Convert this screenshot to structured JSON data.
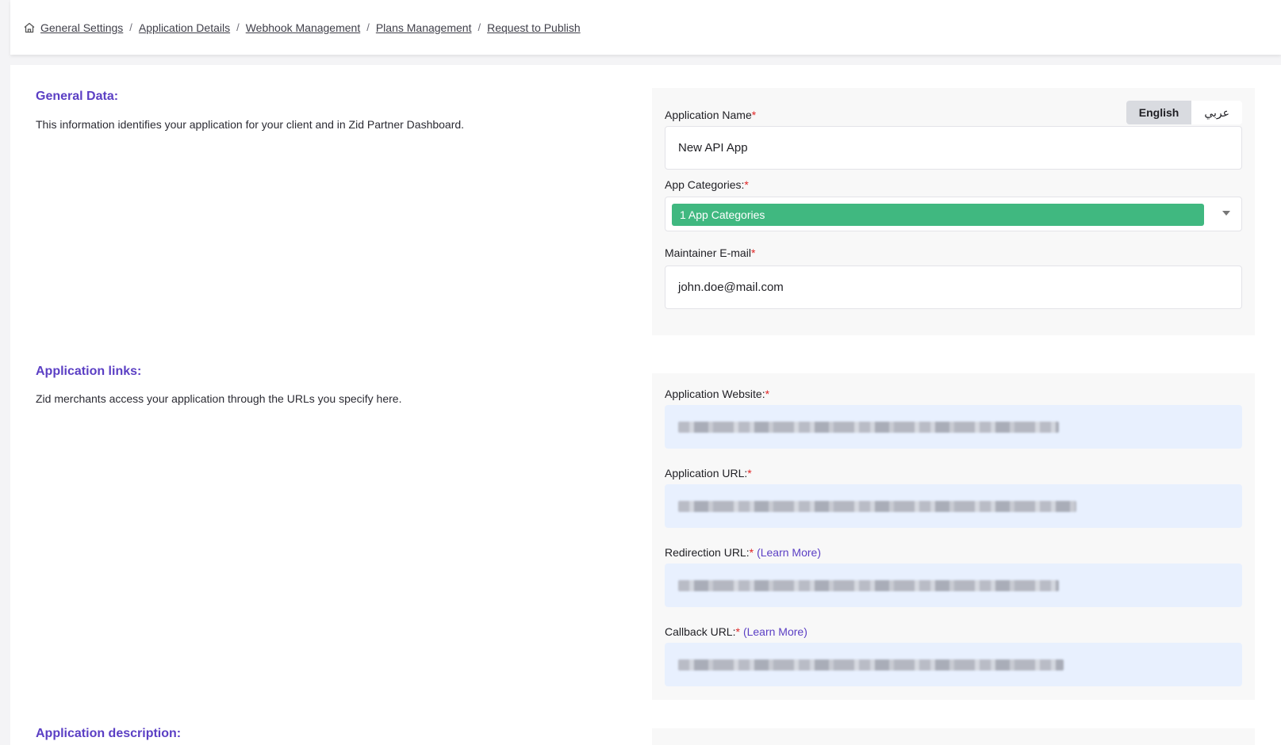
{
  "breadcrumb": {
    "home_icon": "home-icon",
    "items": [
      "General Settings",
      "Application Details",
      "Webhook Management",
      "Plans Management",
      "Request to Publish"
    ],
    "separator": "/"
  },
  "general": {
    "title": "General Data:",
    "description": "This information identifies your application for your client and in Zid Partner Dashboard.",
    "lang_toggle": {
      "english": "English",
      "arabic": "عربي",
      "active": "English"
    },
    "app_name": {
      "label": "Application Name",
      "required": "*",
      "value": "New API App"
    },
    "categories": {
      "label": "App Categories:",
      "required": "*",
      "chip": "1 App Categories"
    },
    "email": {
      "label": "Maintainer E-mail",
      "required": "*",
      "value": "john.doe@mail.com"
    }
  },
  "links": {
    "title": "Application links:",
    "description": "Zid merchants access your application through the URLs you specify here.",
    "website": {
      "label": "Application Website:",
      "required": "*"
    },
    "app_url": {
      "label": "Application URL:",
      "required": "*"
    },
    "redirect_url": {
      "label": "Redirection URL:",
      "required": "*",
      "learn_more": "(Learn More)"
    },
    "callback_url": {
      "label": "Callback URL:",
      "required": "*",
      "learn_more": "(Learn More)"
    }
  },
  "description_section": {
    "title": "Application description:"
  },
  "colors": {
    "accent": "#5b3fc4",
    "required": "#e02424",
    "chip": "#40b880",
    "autofill": "#e8f0fe"
  }
}
